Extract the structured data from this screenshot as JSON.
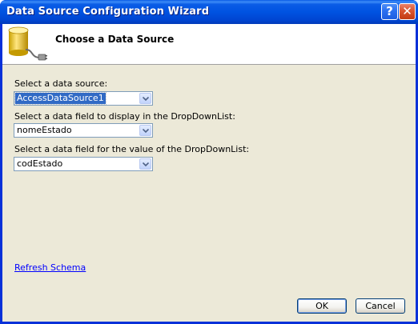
{
  "window": {
    "title": "Data Source Configuration Wizard",
    "help_glyph": "?",
    "close_glyph": "✕"
  },
  "header": {
    "title": "Choose a Data Source",
    "icon": "database-icon"
  },
  "form": {
    "data_source_label": "Select a data source:",
    "data_source_value": "AccessDataSource1",
    "display_field_label": "Select a data field to display in the DropDownList:",
    "display_field_value": "nomeEstado",
    "value_field_label": "Select a data field for the value of the DropDownList:",
    "value_field_value": "codEstado"
  },
  "links": {
    "refresh_schema": "Refresh Schema"
  },
  "buttons": {
    "ok": "OK",
    "cancel": "Cancel"
  },
  "colors": {
    "titlebar": "#0053e1",
    "dialog_face": "#ece9d8",
    "selection": "#316ac5",
    "link": "#0000ff"
  }
}
